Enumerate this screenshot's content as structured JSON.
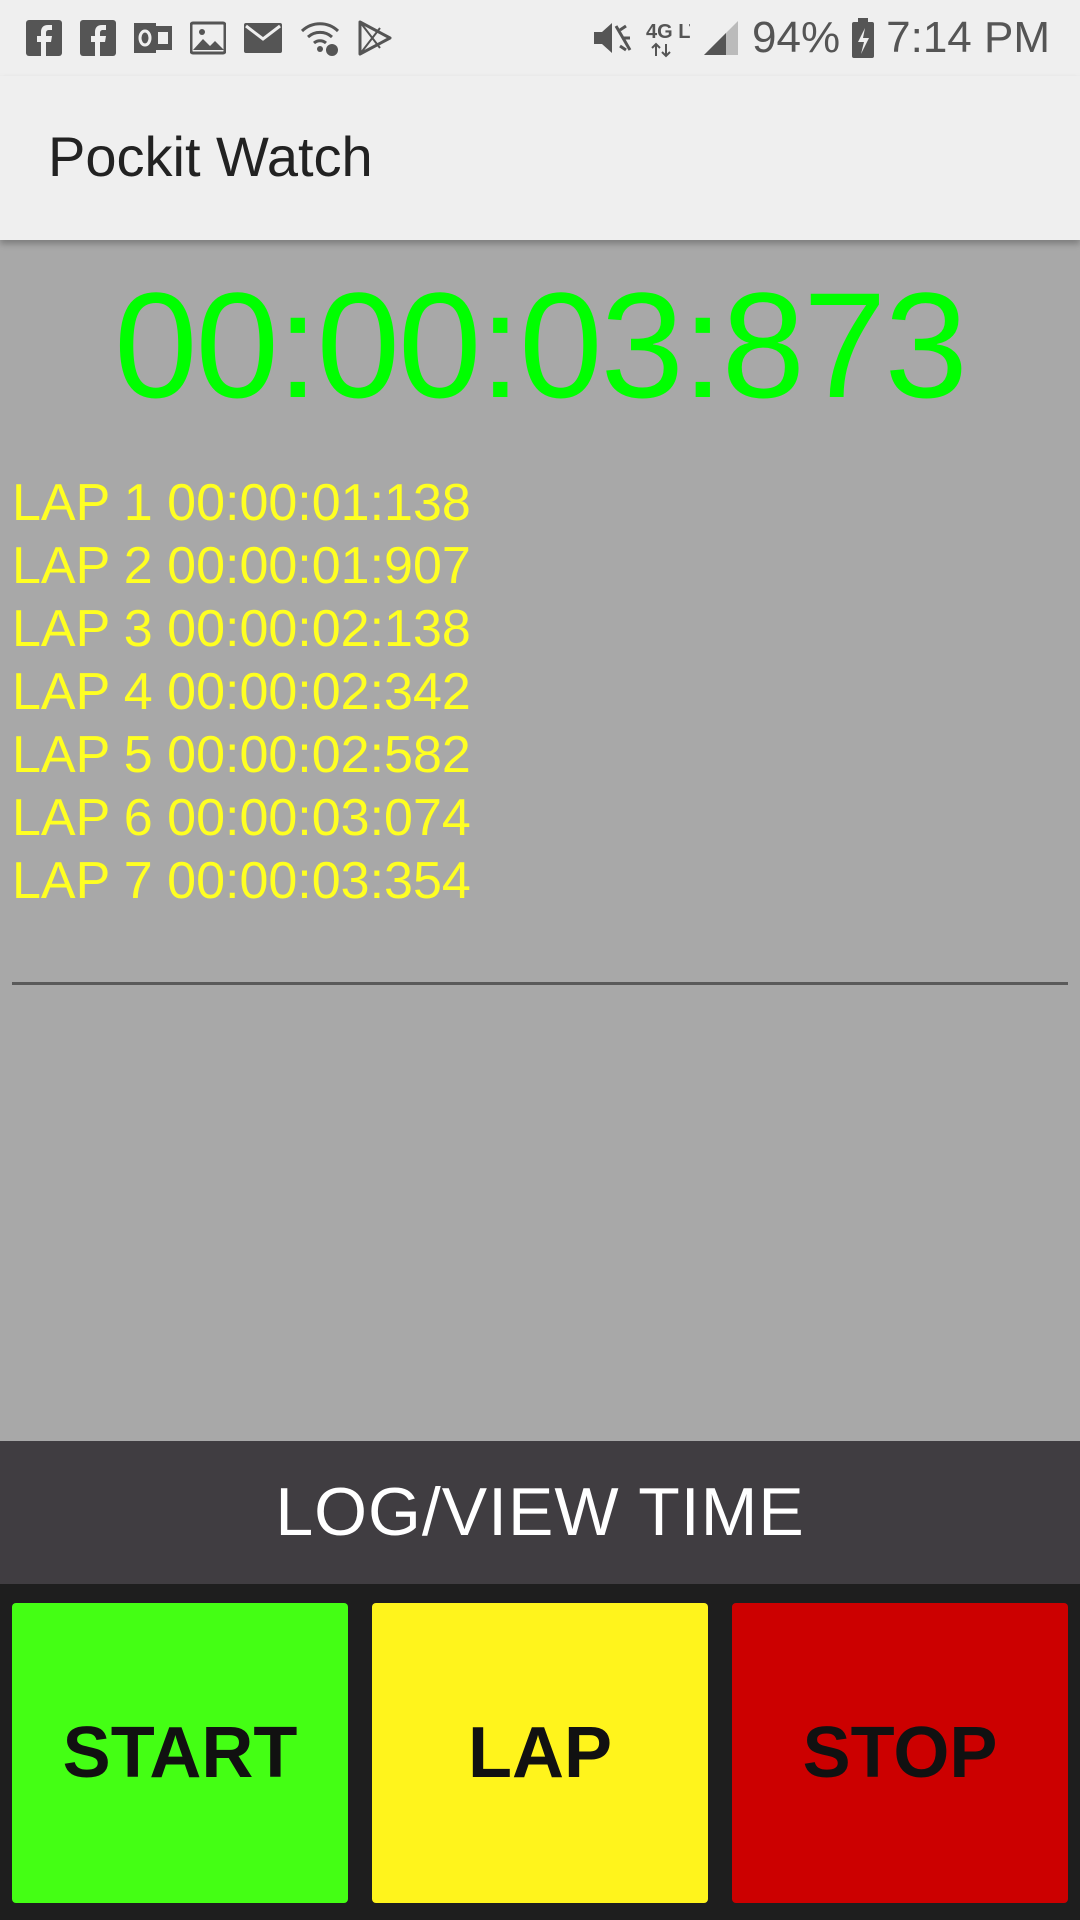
{
  "status_bar": {
    "notification_icons": [
      "facebook-icon",
      "facebook-icon",
      "outlook-icon",
      "gallery-icon",
      "email-icon",
      "wifi-call-icon",
      "play-store-icon"
    ],
    "network": "4G LTE",
    "battery": "94%",
    "time": "7:14 PM"
  },
  "app_bar": {
    "title": "Pockit Watch"
  },
  "timer": {
    "value": "00:00:03:873",
    "color": "#00ff00"
  },
  "laps": [
    "LAP 1 00:00:01:138",
    "LAP 2 00:00:01:907",
    "LAP 3 00:00:02:138",
    "LAP 4 00:00:02:342",
    "LAP 5 00:00:02:582",
    "LAP 6 00:00:03:074",
    "LAP 7 00:00:03:354"
  ],
  "lap_color": "#ffff22",
  "log_button": {
    "label": "LOG/VIEW TIME"
  },
  "controls": {
    "start_label": "START",
    "lap_label": "LAP",
    "stop_label": "STOP",
    "start_color": "#44ff14",
    "lap_color": "#fff41c",
    "stop_color": "#cc0000"
  }
}
